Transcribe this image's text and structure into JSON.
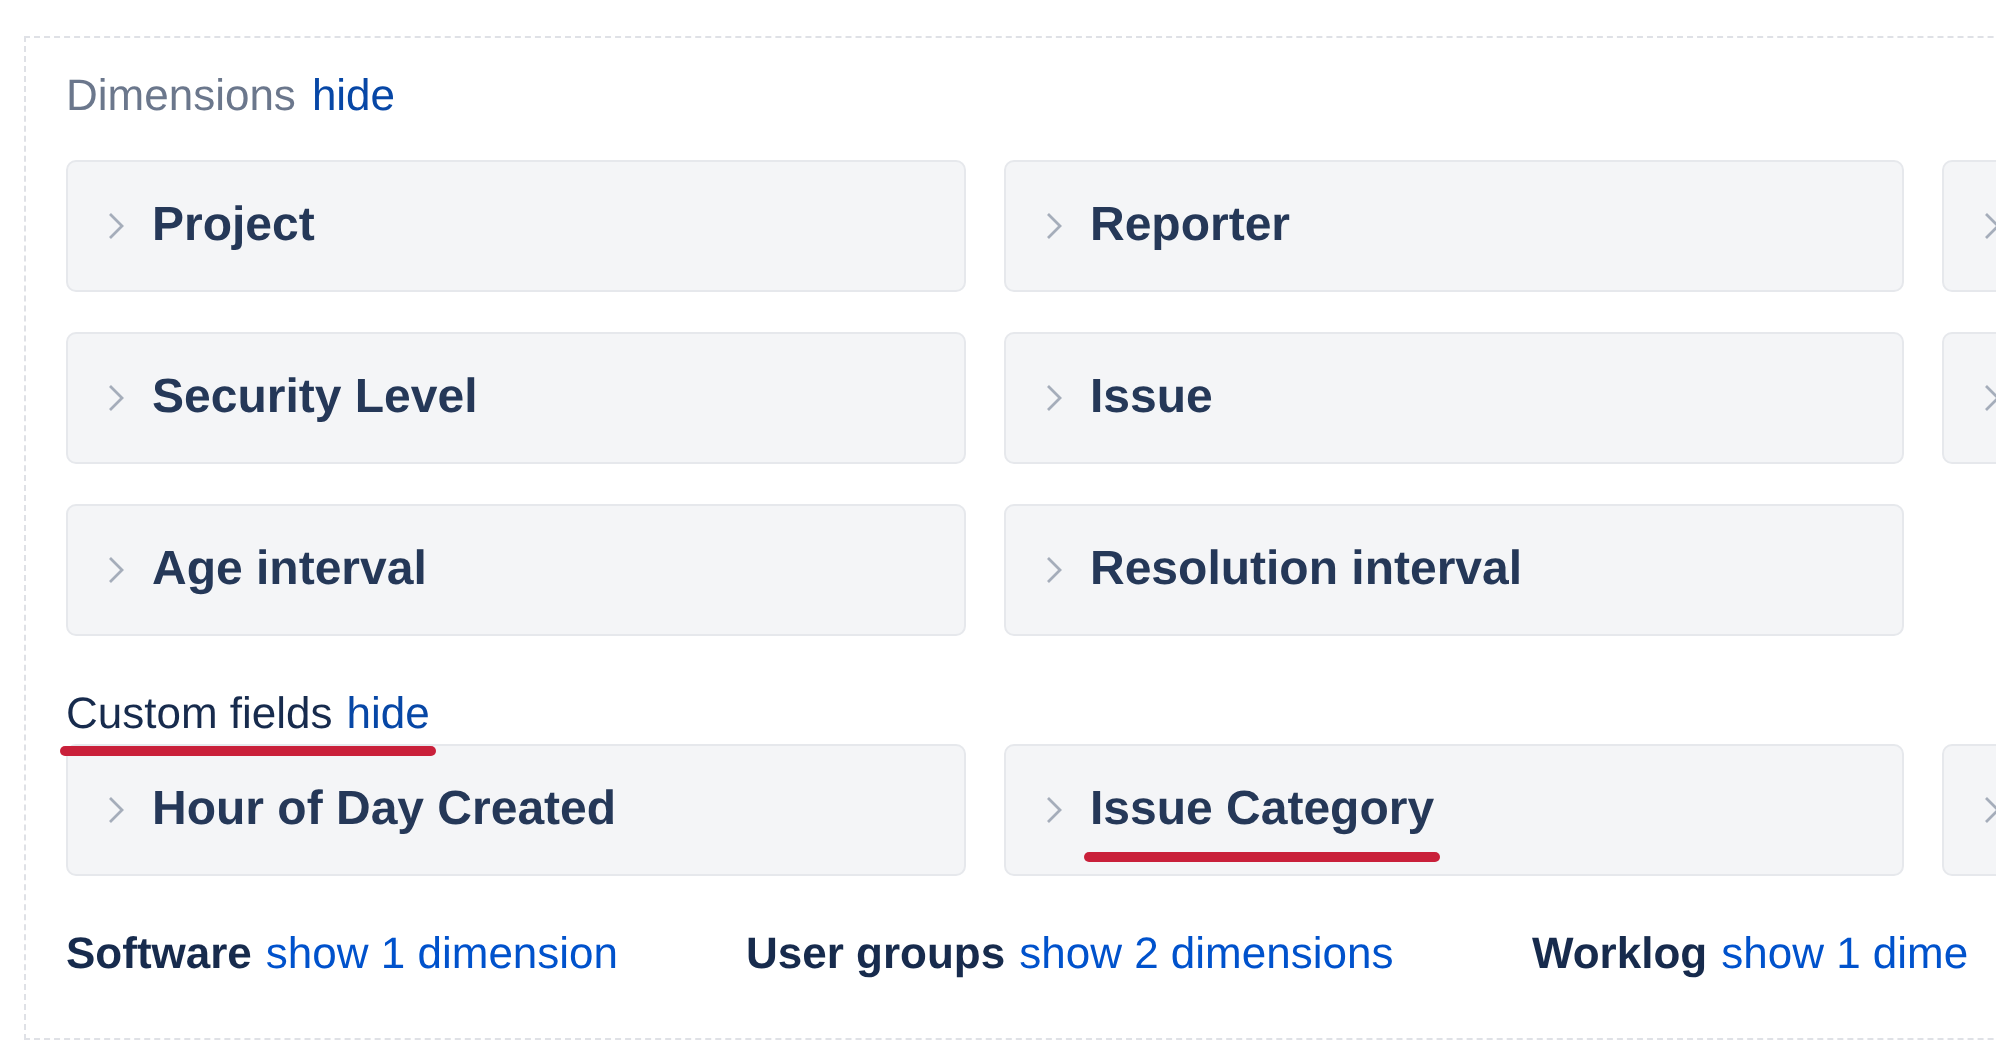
{
  "dimensions": {
    "title": "Dimensions",
    "toggle": "hide",
    "items": [
      {
        "kind": "card",
        "label": "Project",
        "underlined": false
      },
      {
        "kind": "card",
        "label": "Reporter",
        "underlined": false
      },
      {
        "kind": "cut"
      },
      {
        "kind": "card",
        "label": "Security Level",
        "underlined": false
      },
      {
        "kind": "card",
        "label": "Issue",
        "underlined": false
      },
      {
        "kind": "cut"
      },
      {
        "kind": "card",
        "label": "Age interval",
        "underlined": false
      },
      {
        "kind": "card",
        "label": "Resolution interval",
        "underlined": false
      },
      {
        "kind": "empty"
      }
    ]
  },
  "custom_fields": {
    "title": "Custom fields",
    "toggle": "hide",
    "underlined": true,
    "items": [
      {
        "kind": "card",
        "label": "Hour of Day Created",
        "underlined": false
      },
      {
        "kind": "card",
        "label": "Issue Category",
        "underlined": true
      },
      {
        "kind": "cut"
      }
    ]
  },
  "collapsed_groups": [
    {
      "title": "Software",
      "toggle": "show 1 dimension"
    },
    {
      "title": "User groups",
      "toggle": "show 2 dimensions"
    },
    {
      "title": "Worklog",
      "toggle": "show 1 dime"
    }
  ]
}
